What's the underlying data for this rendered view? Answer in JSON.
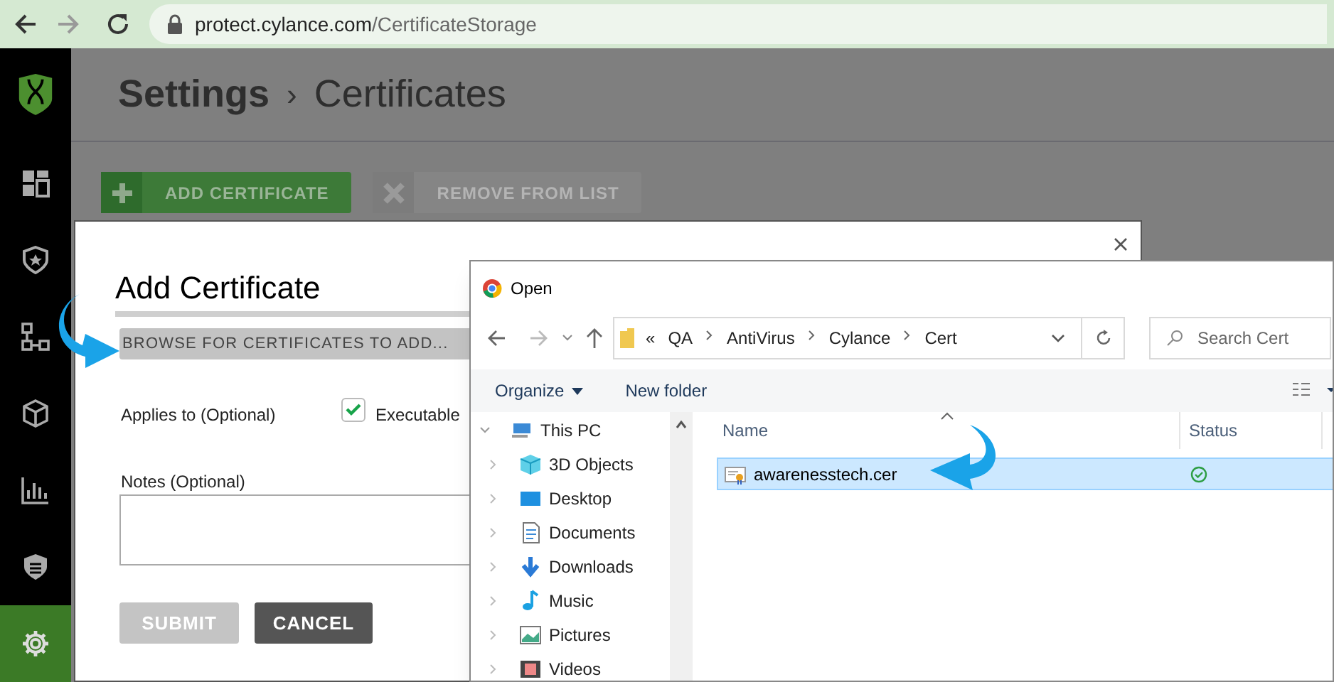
{
  "browser": {
    "url_host": "protect.cylance.com",
    "url_path": "/CertificateStorage"
  },
  "sidebar": {
    "items": [
      {
        "selected": false
      },
      {
        "selected": false
      },
      {
        "selected": false
      },
      {
        "selected": false
      },
      {
        "selected": false
      },
      {
        "selected": false
      },
      {
        "selected": true
      }
    ]
  },
  "page": {
    "breadcrumb": [
      "Settings",
      "Certificates"
    ],
    "separator": "›",
    "toolbar": [
      {
        "label": "ADD CERTIFICATE",
        "disabled": false
      },
      {
        "label": "REMOVE FROM LIST",
        "disabled": true
      }
    ]
  },
  "modal": {
    "title": "Add Certificate",
    "browse_button": "BROWSE FOR CERTIFICATES TO ADD...",
    "applies_label": "Applies to (Optional)",
    "checkbox": {
      "label": "Executable",
      "checked": true
    },
    "notes_label": "Notes (Optional)",
    "buttons": [
      {
        "label": "SUBMIT",
        "disabled": true
      },
      {
        "label": "CANCEL",
        "disabled": false
      }
    ]
  },
  "open_dialog": {
    "title": "Open",
    "address": {
      "prefix": "«",
      "segments": [
        "QA",
        "AntiVirus",
        "Cylance",
        "Cert"
      ]
    },
    "search": {
      "placeholder": "Search Cert"
    },
    "toolbar": [
      "Organize",
      "New folder"
    ],
    "nav_tree": [
      {
        "label": "This PC",
        "expanded": true,
        "children": [
          {
            "label": "3D Objects"
          },
          {
            "label": "Desktop"
          },
          {
            "label": "Documents"
          },
          {
            "label": "Downloads"
          },
          {
            "label": "Music"
          },
          {
            "label": "Pictures"
          },
          {
            "label": "Videos"
          }
        ]
      }
    ],
    "columns": [
      "Name",
      "Status"
    ],
    "files": [
      {
        "name": "awarenesstech.cer",
        "selected": true
      }
    ]
  }
}
